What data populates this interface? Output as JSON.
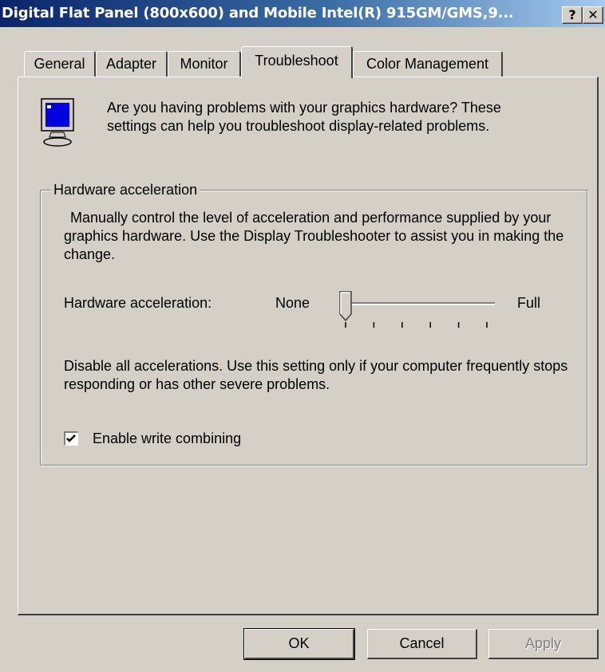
{
  "window": {
    "title": "Digital Flat Panel (800x600) and Mobile Intel(R) 915GM/GMS,9...",
    "help_label": "?",
    "close_label": "✕"
  },
  "tabs": [
    {
      "label": "General"
    },
    {
      "label": "Adapter"
    },
    {
      "label": "Monitor"
    },
    {
      "label": "Troubleshoot",
      "active": true
    },
    {
      "label": "Color Management"
    }
  ],
  "intro": {
    "icon": "monitor-icon",
    "text": "Are you having problems with your graphics hardware? These settings can help you troubleshoot display-related problems."
  },
  "group": {
    "legend": "Hardware acceleration",
    "description": "Manually control the level of acceleration and performance supplied by your graphics hardware. Use the Display Troubleshooter to assist you in making the change.",
    "slider_label": "Hardware acceleration:",
    "min_label": "None",
    "max_label": "Full",
    "slider_value": 0,
    "slider_max": 5,
    "setting_desc": "Disable all accelerations. Use this setting only if your computer frequently stops responding or has other severe problems.",
    "write_combining_label": "Enable write combining",
    "write_combining_checked": true
  },
  "buttons": {
    "ok": "OK",
    "cancel": "Cancel",
    "apply": "Apply"
  },
  "colors": {
    "face": "#d4d0c8",
    "title_start": "#0a246a",
    "title_end": "#a6caf0"
  }
}
